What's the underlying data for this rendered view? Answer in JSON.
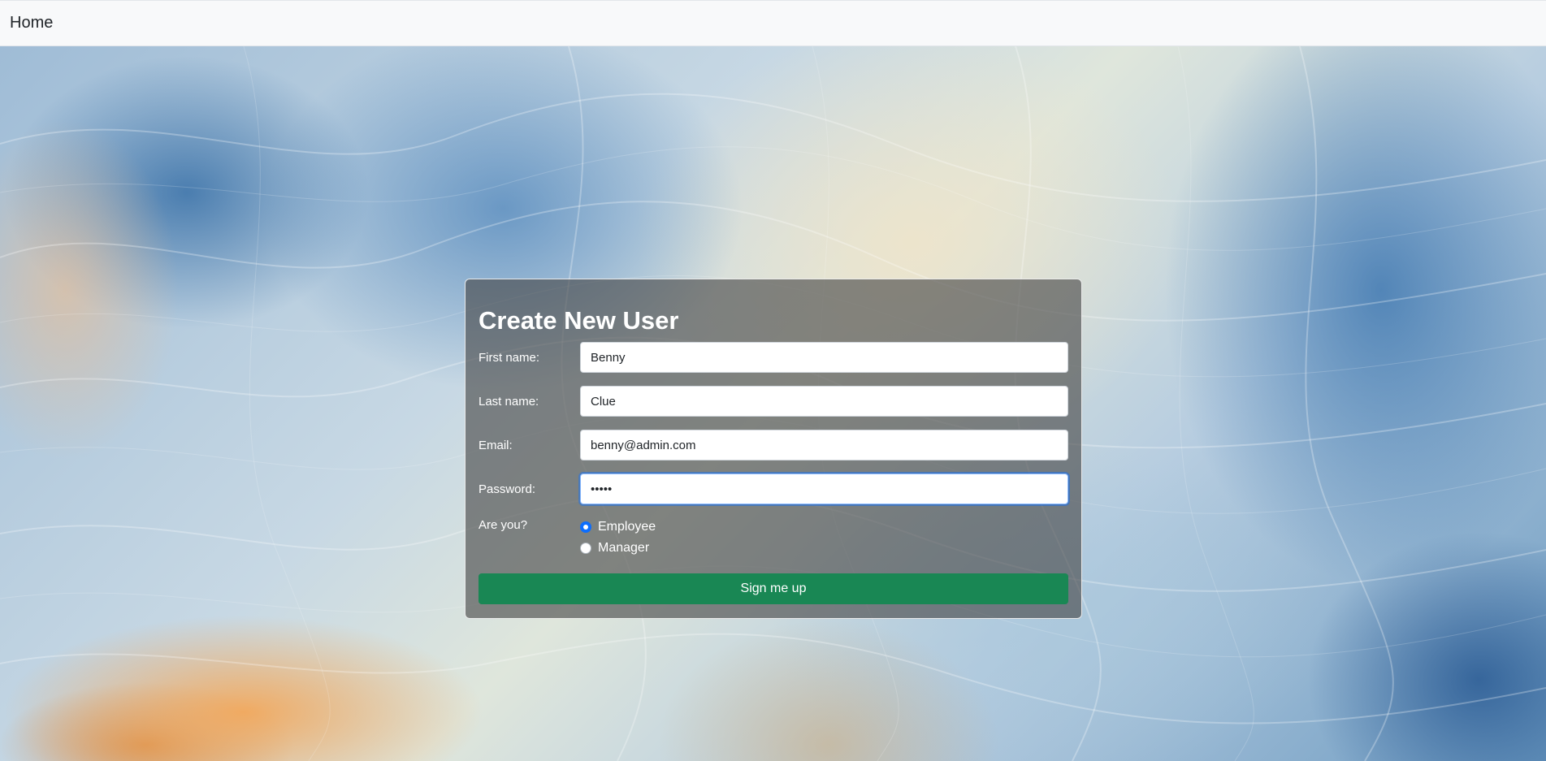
{
  "navbar": {
    "brand_label": "Home"
  },
  "form": {
    "title": "Create New User",
    "first_name": {
      "label": "First name:",
      "value": "Benny"
    },
    "last_name": {
      "label": "Last name:",
      "value": "Clue"
    },
    "email": {
      "label": "Email:",
      "value": "benny@admin.com"
    },
    "password": {
      "label": "Password:",
      "value": "•••••"
    },
    "role": {
      "label": "Are you?",
      "options": [
        "Employee",
        "Manager"
      ],
      "selected": "Employee"
    },
    "submit_label": "Sign me up"
  },
  "colors": {
    "navbar_bg": "#f8f9fa",
    "card_bg": "rgba(70,70,70,0.62)",
    "submit_bg": "#198754",
    "radio_checked": "#0d6efd",
    "focus_ring": "#86b7fe"
  }
}
